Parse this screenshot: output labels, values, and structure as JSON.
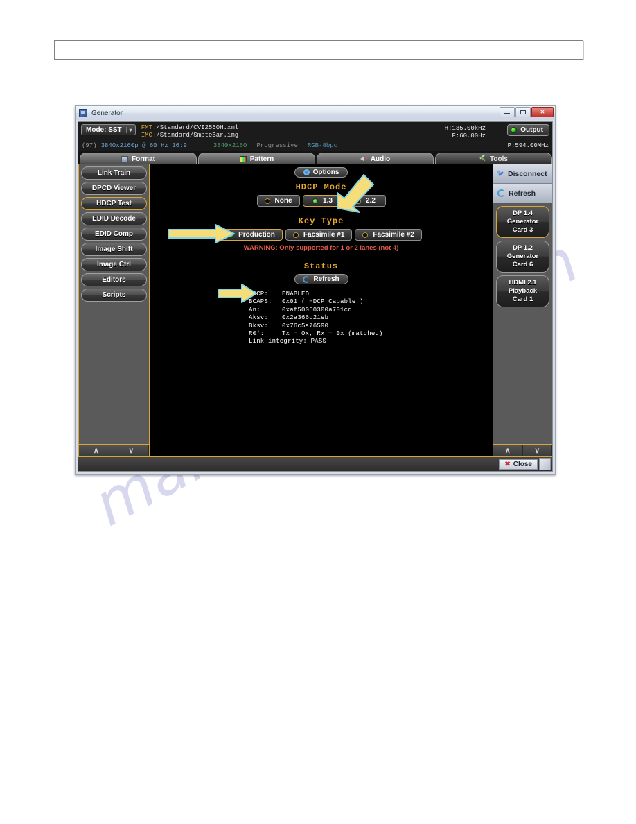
{
  "page": {
    "watermark_text": "manualshive.com"
  },
  "window": {
    "title": "Generator",
    "titlebar_icon": "generator-app-icon",
    "buttons": {
      "minimize": "minimize-icon",
      "maximize": "maximize-icon",
      "close": "✕"
    }
  },
  "infostrip": {
    "mode_label": "Mode: SST",
    "mode_caret": "▾",
    "fmt_key": "FMT:",
    "fmt_value": "/Standard/CVI2560H.xml",
    "img_key": "IMG:",
    "img_value": "/Standard/SmpteBar.img",
    "h_freq": "H:135.00kHz",
    "v_freq": "F:60.00Hz",
    "pixel_clock": "P:594.00MHz",
    "output_label": "Output",
    "output_led_color": "#23c40c",
    "detail_index": "(97)",
    "detail_resolution": "3840x2160p @ 60 Hz 16:9",
    "detail_active": "3840x2160",
    "detail_scan": "Progressive",
    "detail_color": "RGB-8bpc"
  },
  "tabs": [
    {
      "label": "Format",
      "icon": "monitor-icon",
      "active": false
    },
    {
      "label": "Pattern",
      "icon": "colorbar-icon",
      "active": false
    },
    {
      "label": "Audio",
      "icon": "speaker-icon",
      "active": false
    },
    {
      "label": "Tools",
      "icon": "tools-icon",
      "active": true
    }
  ],
  "sidebar_left": {
    "items": [
      {
        "label": "Link Train",
        "selected": false
      },
      {
        "label": "DPCD Viewer",
        "selected": false
      },
      {
        "label": "HDCP Test",
        "selected": true
      },
      {
        "label": "EDID Decode",
        "selected": false
      },
      {
        "label": "EDID Comp",
        "selected": false
      },
      {
        "label": "Image Shift",
        "selected": false
      },
      {
        "label": "Image Ctrl",
        "selected": false
      },
      {
        "label": "Editors",
        "selected": false
      },
      {
        "label": "Scripts",
        "selected": false
      }
    ],
    "scroll_up": "∧",
    "scroll_down": "∨"
  },
  "main": {
    "options_label": "Options",
    "hdcp_mode": {
      "title": "HDCP Mode",
      "options": [
        {
          "label": "None",
          "selected": false
        },
        {
          "label": "1.3",
          "selected": true
        },
        {
          "label": "2.2",
          "selected": false
        }
      ]
    },
    "key_type": {
      "title": "Key Type",
      "options": [
        {
          "label": "Production",
          "selected": true
        },
        {
          "label": "Facsimile #1",
          "selected": false
        },
        {
          "label": "Facsimile #2",
          "selected": false
        }
      ],
      "warning": "WARNING: Only supported for 1 or 2 lanes (not 4)",
      "warning_color": "#e05b4a"
    },
    "status": {
      "title": "Status",
      "refresh_label": "Refresh",
      "rows": [
        {
          "label": "HDCP:",
          "value": "ENABLED"
        },
        {
          "label": "BCAPS:",
          "value": "0x01 ( HDCP Capable  )"
        },
        {
          "label": "An:",
          "value": "0xaf50050300a701cd"
        },
        {
          "label": "Aksv:",
          "value": "0x2a366d21eb"
        },
        {
          "label": "Bksv:",
          "value": "0x76c5a76590"
        },
        {
          "label": "R0':",
          "value": "Tx = 0x, Rx = 0x (matched)"
        },
        {
          "label": "Link integrity:",
          "value": "PASS",
          "inline": true
        }
      ]
    }
  },
  "sidebar_right": {
    "disconnect_label": "Disconnect",
    "refresh_label": "Refresh",
    "cards": [
      {
        "line1": "DP 1.4",
        "line2": "Generator",
        "line3": "Card 3",
        "selected": true
      },
      {
        "line1": "DP 1.2",
        "line2": "Generator",
        "line3": "Card 6",
        "selected": false
      },
      {
        "line1": "HDMI 2.1",
        "line2": "Playback",
        "line3": "Card 1",
        "selected": false
      }
    ],
    "scroll_up": "∧",
    "scroll_down": "∨"
  },
  "bottombar": {
    "close_label": "Close",
    "close_icon": "✖"
  },
  "annotations": {
    "arrow_color": "#f5dd7a",
    "arrow_border": "#7fd4e8",
    "arrow_hdcp_mode_target": "hdcp-mode-1-3",
    "arrow_key_type_target": "key-type-production",
    "arrow_status_target": "status-hdcp-row"
  },
  "theme": {
    "accent_gold": "#d8a63a",
    "title_gold": "#e8a72e",
    "panel_dark": "#141414",
    "panel_gray": "#5a5a5a"
  }
}
